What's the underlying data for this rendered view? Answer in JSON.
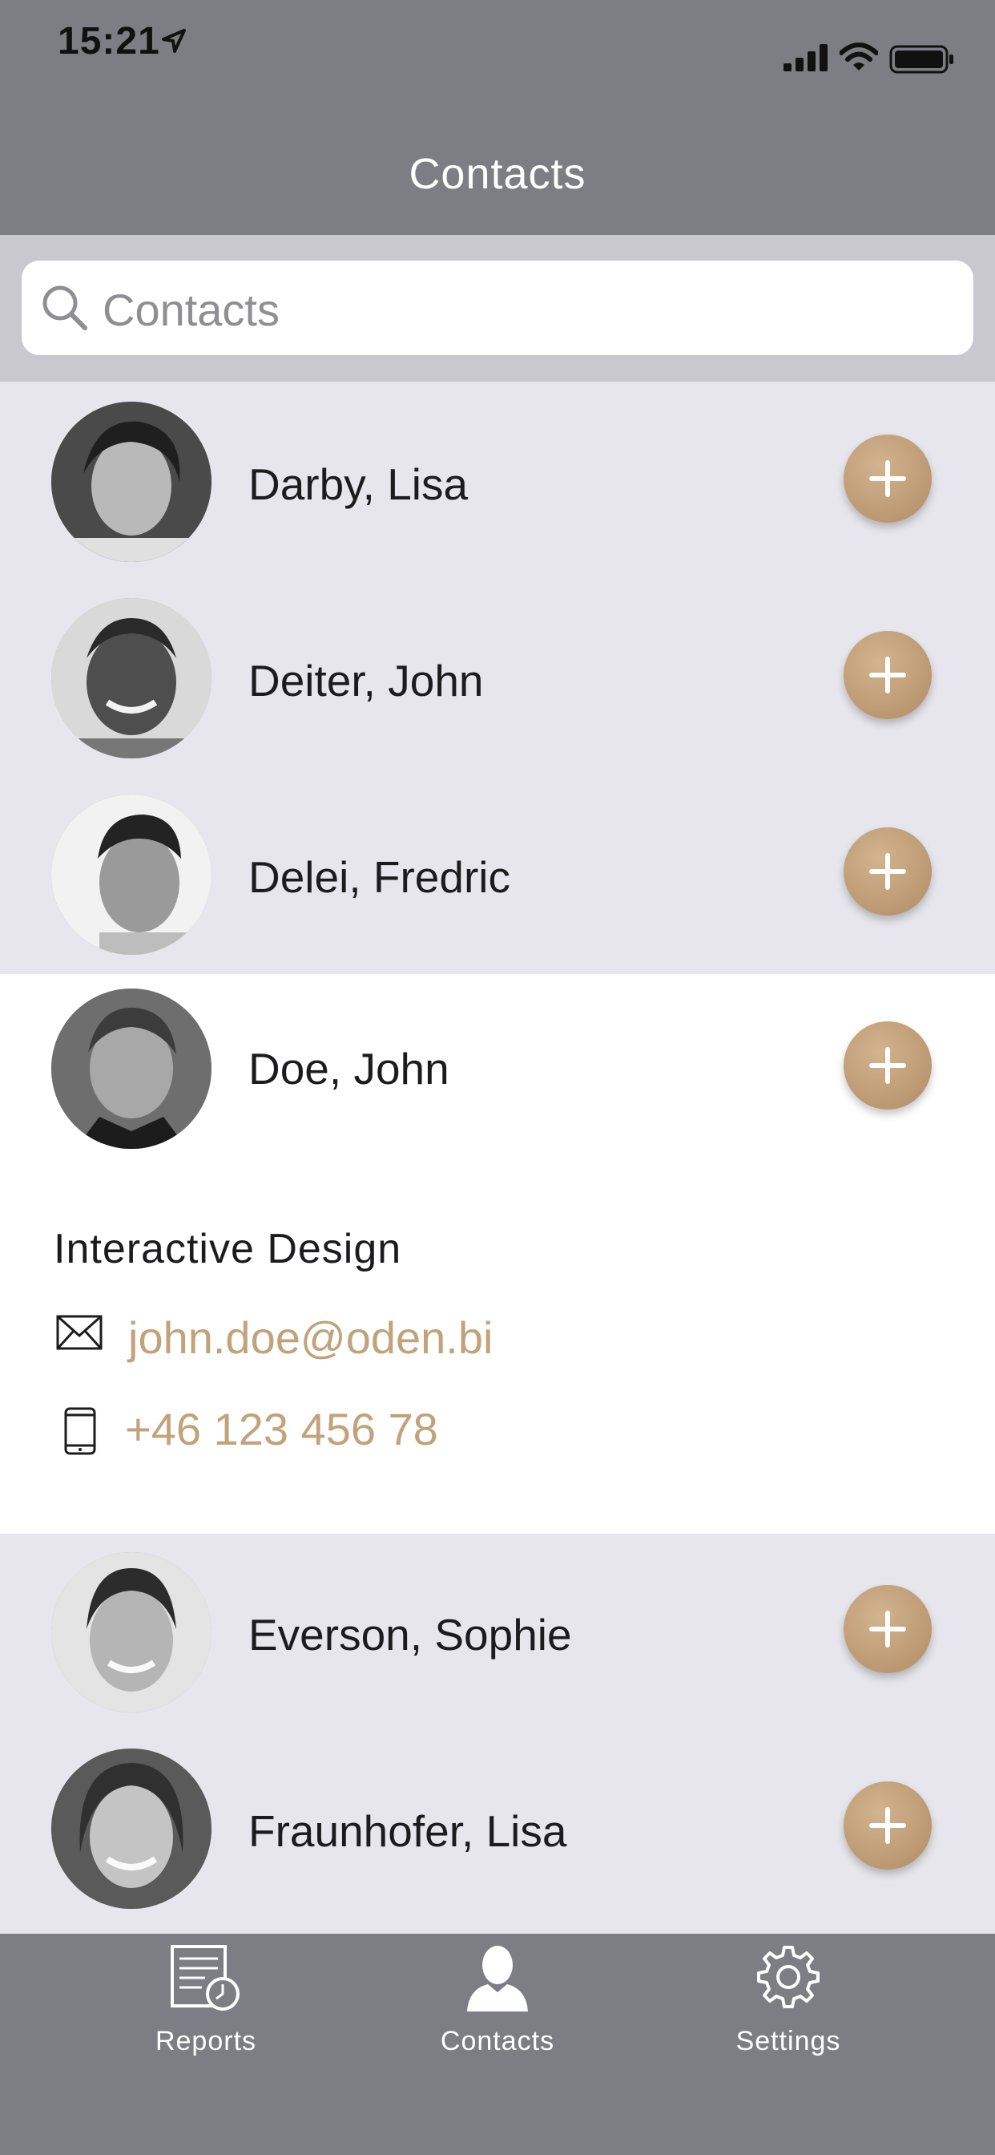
{
  "status_bar": {
    "time": "15:21"
  },
  "nav": {
    "title": "Contacts"
  },
  "search": {
    "placeholder": "Contacts"
  },
  "contacts": [
    {
      "name": "Darby, Lisa"
    },
    {
      "name": "Deiter, John"
    },
    {
      "name": "Delei, Fredric"
    },
    {
      "name": "Doe, John",
      "department": "Interactive Design",
      "email": "john.doe@oden.bi",
      "phone": "+46 123 456 78"
    },
    {
      "name": "Everson, Sophie"
    },
    {
      "name": "Fraunhofer, Lisa"
    }
  ],
  "tabs": [
    {
      "label": "Reports",
      "icon": "reports-icon"
    },
    {
      "label": "Contacts",
      "icon": "contacts-icon"
    },
    {
      "label": "Settings",
      "icon": "settings-icon"
    }
  ],
  "colors": {
    "bar_background": "#7d7e83",
    "list_background": "#e6e6ec",
    "accent_gold": "#c2a27a"
  }
}
